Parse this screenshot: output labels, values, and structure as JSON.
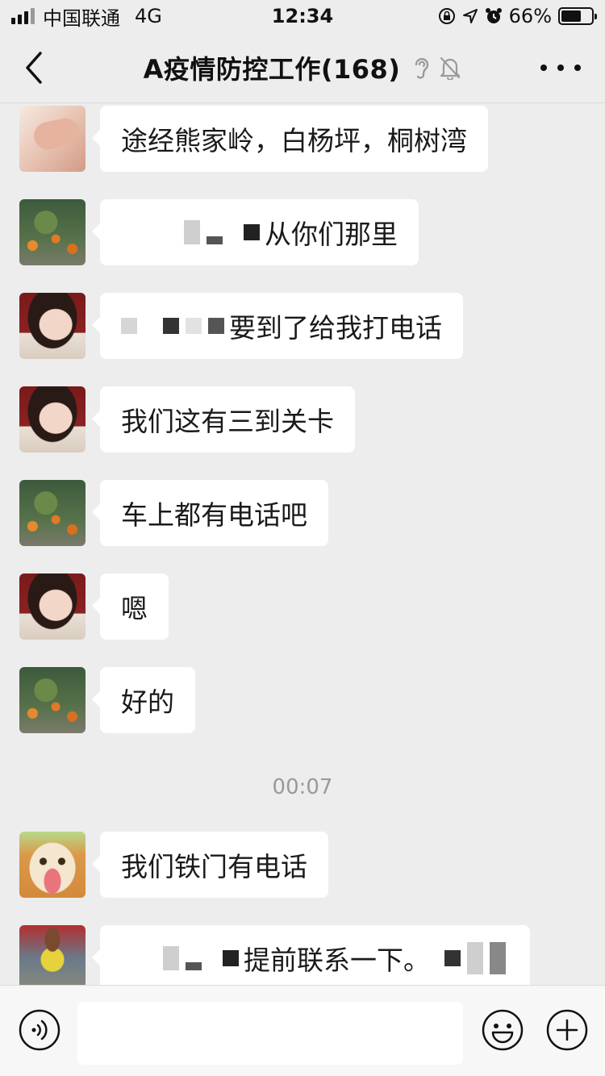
{
  "status_bar": {
    "carrier": "中国联通",
    "network": "4G",
    "time": "12:34",
    "battery": "66%",
    "battery_level": 0.66,
    "icons": [
      "signal-icon",
      "orientation-lock-icon",
      "location-icon",
      "alarm-icon",
      "battery-icon"
    ]
  },
  "header": {
    "title": "A疫情防控工作(168)",
    "icons": [
      "back-icon",
      "earpiece-icon",
      "mute-notification-icon",
      "more-icon"
    ]
  },
  "messages": [
    {
      "avatar": "hand-avatar",
      "text": "途经熊家岭，白杨坪，桐树湾"
    },
    {
      "avatar": "orange-tree-avatar",
      "text": "从你们那里",
      "redacted_prefix": true
    },
    {
      "avatar": "woman-avatar",
      "text": "要到了给我打电话",
      "redacted_prefix": true
    },
    {
      "avatar": "woman-avatar",
      "text": "我们这有三到关卡"
    },
    {
      "avatar": "orange-tree-avatar",
      "text": "车上都有电话吧"
    },
    {
      "avatar": "woman-avatar",
      "text": "嗯"
    },
    {
      "avatar": "orange-tree-avatar",
      "text": "好的"
    },
    {
      "avatar": "dog-avatar",
      "text": "我们铁门有电话"
    },
    {
      "avatar": "man-avatar",
      "text": "提前联系一下。",
      "redacted_prefix": true
    }
  ],
  "time_separator": "00:07",
  "input_bar": {
    "placeholder": "",
    "icons": [
      "voice-icon",
      "emoji-icon",
      "plus-icon"
    ]
  }
}
